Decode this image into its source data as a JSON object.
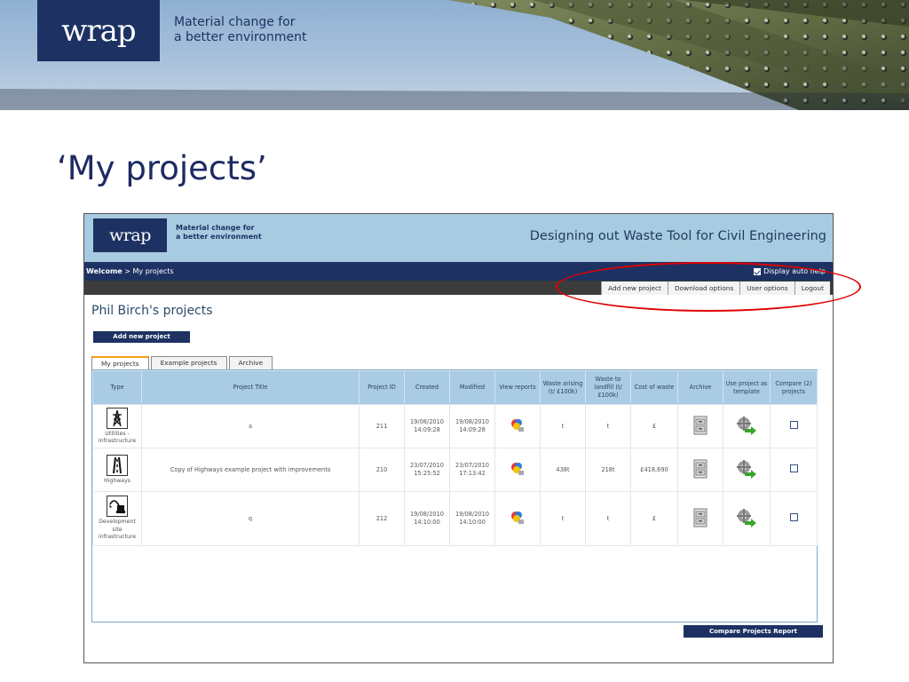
{
  "slide": {
    "logo_text": "wrap",
    "tagline_line1": "Material change for",
    "tagline_line2": "a better environment",
    "title": "‘My projects’"
  },
  "app": {
    "logo_text": "wrap",
    "tagline_line1": "Material change for",
    "tagline_line2": "a better environment",
    "title": "Designing out Waste Tool for Civil Engineering",
    "breadcrumb": {
      "welcome": "Welcome",
      "separator": ">",
      "current": "My projects"
    },
    "auto_help": {
      "label": "Display auto help",
      "checked": true
    },
    "menu": [
      "Add new project",
      "Download options",
      "User options",
      "Logout"
    ],
    "page_heading": "Phil Birch's projects",
    "add_button": "Add new project",
    "tabs": [
      {
        "label": "My projects",
        "active": true
      },
      {
        "label": "Example projects",
        "active": false
      },
      {
        "label": "Archive",
        "active": false
      }
    ],
    "columns": [
      "Type",
      "Project Title",
      "Project ID",
      "Created",
      "Modified",
      "View reports",
      "Waste arising (t/ £100k)",
      "Waste to landfill (t/ £100k)",
      "Cost of waste",
      "Archive",
      "Use project as template",
      "Compare (2) projects"
    ],
    "rows": [
      {
        "type_icon": "pylon-icon",
        "type": "Utilities - Infrastructure",
        "title": "a",
        "id": "211",
        "created": "19/08/2010 14:09:28",
        "modified": "19/08/2010 14:09:28",
        "waste_arising": "t",
        "waste_landfill": "t",
        "cost": "£"
      },
      {
        "type_icon": "highway-icon",
        "type": "Highways",
        "title": "Copy of Highways example project with improvements",
        "id": "210",
        "created": "23/07/2010 15:25:52",
        "modified": "23/07/2010 17:13:42",
        "waste_arising": "438t",
        "waste_landfill": "218t",
        "cost": "£418,690"
      },
      {
        "type_icon": "excavator-icon",
        "type": "Development site infrastructure",
        "title": "q",
        "id": "212",
        "created": "19/08/2010 14:10:00",
        "modified": "19/08/2010 14:10:00",
        "waste_arising": "t",
        "waste_landfill": "t",
        "cost": "£"
      }
    ],
    "compare_button": "Compare Projects Report"
  },
  "colors": {
    "navy": "#1d3263",
    "header_blue": "#a7cbe1",
    "table_header": "#a9cbe4",
    "annotation_red": "#e00000",
    "tab_accent": "#f2a019"
  }
}
